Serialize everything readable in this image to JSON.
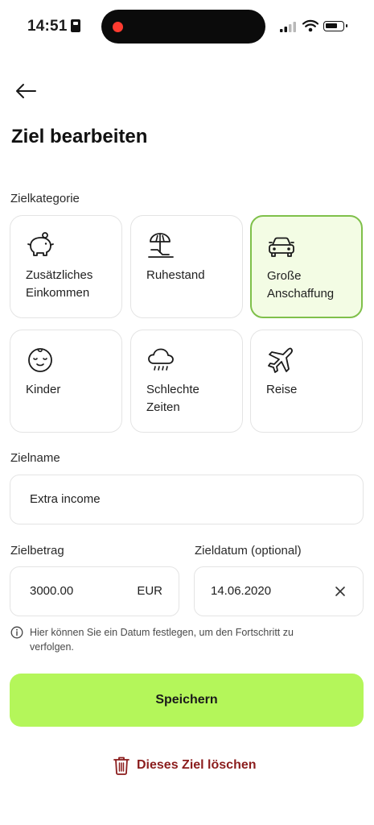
{
  "status_bar": {
    "time": "14:51"
  },
  "page": {
    "title": "Ziel bearbeiten"
  },
  "category": {
    "label": "Zielkategorie",
    "items": [
      {
        "label": "Zusätzliches\nEinkommen",
        "icon": "piggy-bank-icon",
        "selected": false
      },
      {
        "label": "Ruhestand",
        "icon": "beach-umbrella-icon",
        "selected": false
      },
      {
        "label": "Große\nAnschaffung",
        "icon": "car-icon",
        "selected": true
      },
      {
        "label": "Kinder",
        "icon": "baby-face-icon",
        "selected": false
      },
      {
        "label": "Schlechte\nZeiten",
        "icon": "storm-cloud-icon",
        "selected": false
      },
      {
        "label": "Reise",
        "icon": "airplane-icon",
        "selected": false
      }
    ]
  },
  "goal_name": {
    "label": "Zielname",
    "value": "Extra income"
  },
  "goal_amount": {
    "label": "Zielbetrag",
    "value": "3000.00",
    "currency": "EUR"
  },
  "goal_date": {
    "label": "Zieldatum (optional)",
    "value": "14.06.2020"
  },
  "info": {
    "text": "Hier können Sie ein Datum festlegen, um den Fortschritt zu verfolgen."
  },
  "actions": {
    "save_label": "Speichern",
    "delete_label": "Dieses Ziel löschen"
  },
  "colors": {
    "accent": "#b4f65a",
    "selected_bg": "#f3fce4",
    "selected_border": "#7fc04a",
    "danger": "#8b1d1d"
  }
}
